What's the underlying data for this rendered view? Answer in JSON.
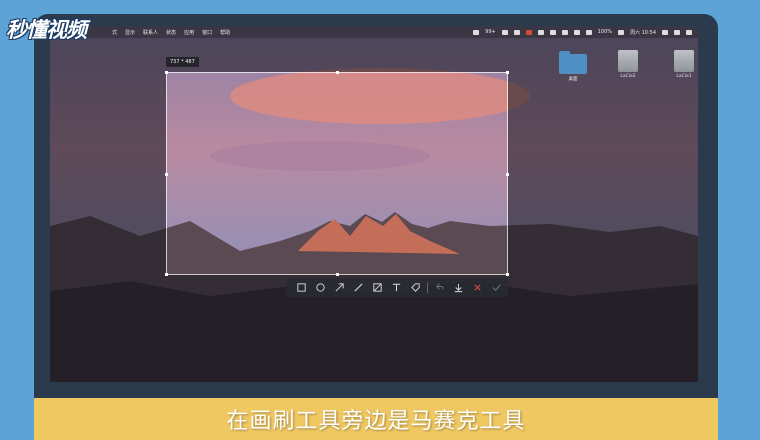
{
  "logo": {
    "text": "秒懂视频"
  },
  "menubar": {
    "items": [
      "式",
      "显示",
      "联系人",
      "状态",
      "应用",
      "窗口",
      "帮助"
    ],
    "status": {
      "badge": "99+",
      "battery": "100%",
      "clock": "周六 10:54"
    }
  },
  "desktop": {
    "icons": [
      {
        "label": "桌面",
        "icon": "folder-icon"
      },
      {
        "label": "LaCie2",
        "icon": "drive-icon"
      },
      {
        "label": "LaCie1",
        "icon": "drive-icon"
      }
    ]
  },
  "selection": {
    "size_label": "737 * 487"
  },
  "toolbar": {
    "tools": [
      "rectangle-tool",
      "ellipse-tool",
      "arrow-tool",
      "brush-tool",
      "mosaic-tool",
      "text-tool",
      "tag-tool",
      "undo",
      "download",
      "cancel",
      "confirm"
    ]
  },
  "caption": {
    "text": "在画刷工具旁边是马赛克工具"
  },
  "colors": {
    "accent": "#f0c862",
    "background": "#5ea3d6",
    "bezel": "#2b3a4d"
  }
}
